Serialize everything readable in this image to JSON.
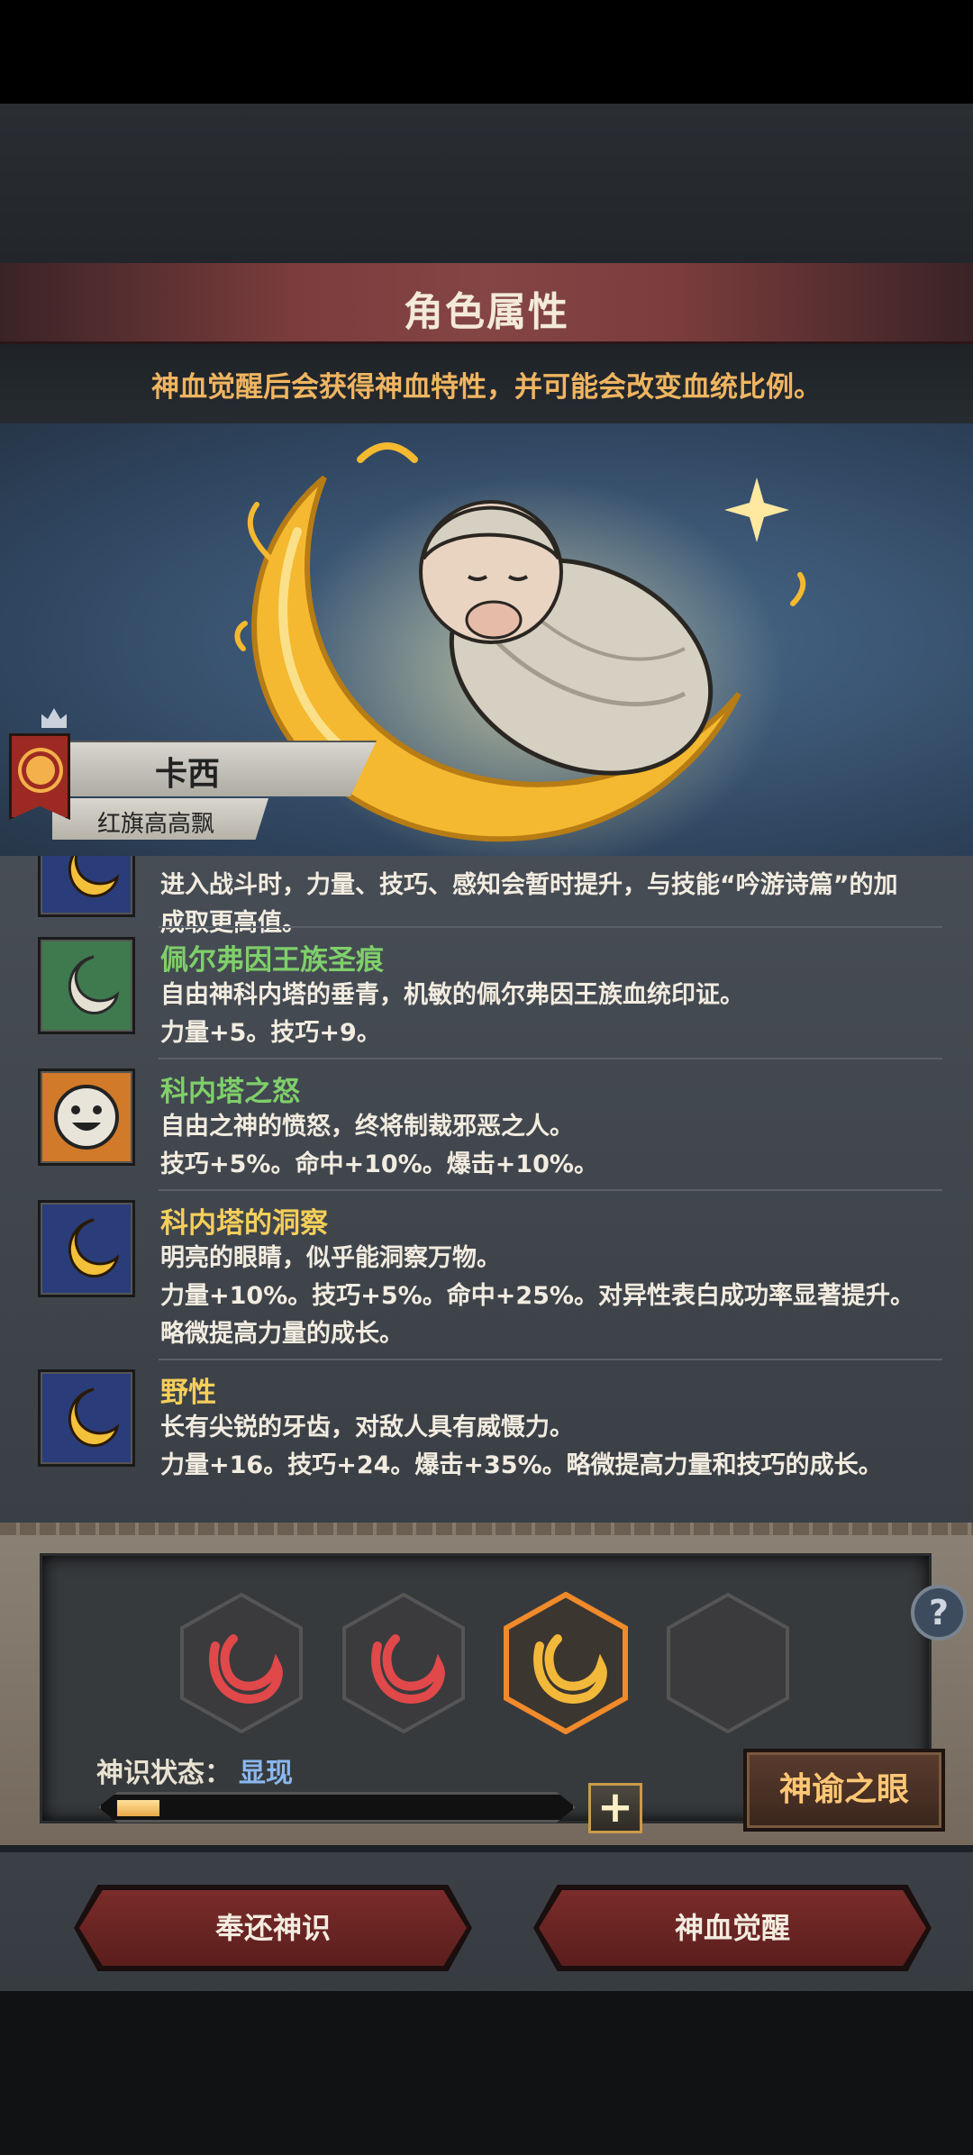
{
  "panel": {
    "title": "角色属性",
    "tip": "神血觉醒后会获得神血特性，并可能会改变血统比例。"
  },
  "character": {
    "name": "卡西",
    "subtitle": "红旗高高飘"
  },
  "traits": [
    {
      "name": "",
      "name_color": "#f5cf5a",
      "lines": [
        "进入战斗时，力量、技巧、感知会暂时提升，与技能“吟游诗篇”的加",
        "成取更高值。"
      ],
      "icon": "crescent-moon-icon"
    },
    {
      "name": "佩尔弗因王族圣痕",
      "name_color": "#7fcf6a",
      "lines": [
        "自由神科内塔的垂青，机敏的佩尔弗因王族血统印证。",
        "力量+5。技巧+9。"
      ],
      "icon": "white-crescent-icon"
    },
    {
      "name": "科内塔之怒",
      "name_color": "#7fcf6a",
      "lines": [
        "自由之神的愤怒，终将制裁邪恶之人。",
        "技巧+5%。命中+10%。爆击+10%。"
      ],
      "icon": "smiling-face-icon"
    },
    {
      "name": "科内塔的洞察",
      "name_color": "#f5cf5a",
      "lines": [
        "明亮的眼睛，似乎能洞察万物。",
        "力量+10%。技巧+5%。命中+25%。对异性表白成功率显著提升。",
        "略微提高力量的成长。"
      ],
      "icon": "crescent-moon-icon"
    },
    {
      "name": "野性",
      "name_color": "#f5cf5a",
      "lines": [
        "长有尖锐的牙齿，对敌人具有威慑力。",
        "力量+16。技巧+24。爆击+35%。略微提高力量和技巧的成长。"
      ],
      "icon": "crescent-moon-icon"
    }
  ],
  "control": {
    "status_label": "神识状态：",
    "status_value": "显现",
    "progress": 0.1,
    "plus_label": "+",
    "oracle_label": "神谕之眼",
    "help_label": "?"
  },
  "footer": {
    "return_label": "奉还神识",
    "awaken_label": "神血觉醒"
  },
  "colors": {
    "accent_gold": "#f0b560",
    "trait_green": "#7fcf6a",
    "trait_yellow": "#f5cf5a",
    "status_blue": "#8bb8ee"
  }
}
